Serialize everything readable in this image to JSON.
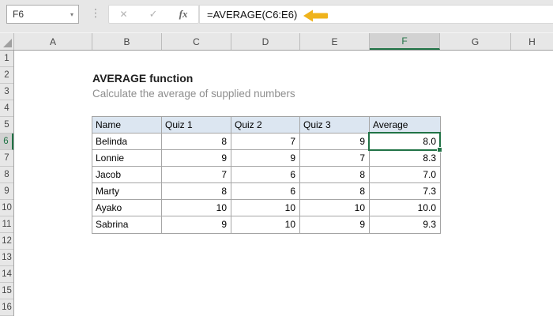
{
  "formula_bar": {
    "name_box_value": "F6",
    "dropdown_icon": "▾",
    "separator_icon": "⋮",
    "cancel_icon": "✕",
    "enter_icon": "✓",
    "fx_icon": "fx",
    "formula": "=AVERAGE(C6:E6)"
  },
  "sheet": {
    "column_letters": [
      "A",
      "B",
      "C",
      "D",
      "E",
      "F",
      "G",
      "H"
    ],
    "row_numbers": [
      "1",
      "2",
      "3",
      "4",
      "5",
      "6",
      "7",
      "8",
      "9",
      "10",
      "11",
      "12",
      "13",
      "14",
      "15",
      "16"
    ],
    "selected_cell": "F6",
    "selected_column": "F",
    "selected_row": "6"
  },
  "doc": {
    "title": "AVERAGE function",
    "subtitle": "Calculate the average of supplied numbers"
  },
  "table": {
    "headers": [
      "Name",
      "Quiz 1",
      "Quiz 2",
      "Quiz 3",
      "Average"
    ],
    "rows": [
      [
        "Belinda",
        "8",
        "7",
        "9",
        "8.0"
      ],
      [
        "Lonnie",
        "9",
        "9",
        "7",
        "8.3"
      ],
      [
        "Jacob",
        "7",
        "6",
        "8",
        "7.0"
      ],
      [
        "Marty",
        "8",
        "6",
        "8",
        "7.3"
      ],
      [
        "Ayako",
        "10",
        "10",
        "10",
        "10.0"
      ],
      [
        "Sabrina",
        "9",
        "10",
        "9",
        "9.3"
      ]
    ]
  },
  "colors": {
    "accent_green": "#217346",
    "callout_arrow": "#EFB31C",
    "table_header_bg": "#DCE6F1",
    "selected_header_bg": "#D2D2D2",
    "chrome_bg": "#E7E7E7"
  }
}
